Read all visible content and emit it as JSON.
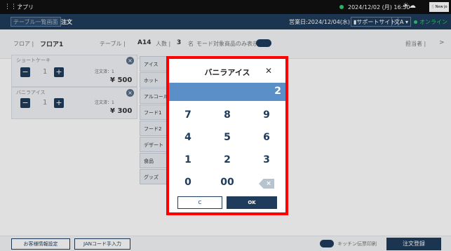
{
  "topbar": {
    "app_name": "アプリ",
    "datetime": "2024/12/02 (月) 16:50",
    "user_initial": "New jo"
  },
  "subbar": {
    "back_label": "テーブル一覧画面",
    "title": "注文",
    "business_date": "営業日:2024/12/04(水)",
    "support": "サポートサイト",
    "lang": "文A",
    "status": "オンライン"
  },
  "info": {
    "floor_label": "フロア |",
    "floor_value": "フロア1",
    "table_label": "テーブル |",
    "table_value": "A14",
    "people_label": "人数 |",
    "people_value": "3",
    "people_unit": "名",
    "mode_label": "モード対象商品のみ表示",
    "staff_label": "担当者 |",
    "chevron": ">"
  },
  "orders": [
    {
      "name": "ショートケーキ",
      "qty": "1",
      "order_no_label": "注文済：1",
      "price": "¥ 500"
    },
    {
      "name": "バニラアイス",
      "qty": "1",
      "order_no_label": "注文済：1",
      "price": "¥ 300"
    }
  ],
  "categories": [
    "アイス",
    "ホット",
    "アルコール",
    "フード1",
    "フード2",
    "デザート",
    "食品",
    "グッズ"
  ],
  "keypad": {
    "title": "バニラアイス",
    "display": "2",
    "keys": [
      "7",
      "8",
      "9",
      "4",
      "5",
      "6",
      "1",
      "2",
      "3",
      "0",
      "00"
    ],
    "clear_label": "C",
    "ok_label": "OK"
  },
  "footer": {
    "customer_btn": "お客様情報設定",
    "jan_btn": "JANコード手入力",
    "kitchen_toggle": "キッチン伝票印刷",
    "submit": "注文登録"
  },
  "colors": {
    "navy": "#1f3c5c",
    "accent_blue": "#5b8fc7",
    "red_frame": "#ff0000",
    "online_green": "#2ecc71"
  }
}
